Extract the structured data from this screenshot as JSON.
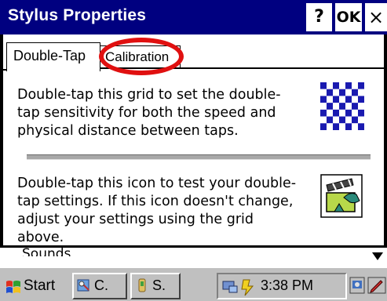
{
  "window": {
    "title": "Stylus Properties",
    "help_label": "?",
    "ok_label": "OK",
    "close_label": "×"
  },
  "tabs": [
    {
      "label": "Double-Tap",
      "active": true
    },
    {
      "label": "Calibration",
      "active": false,
      "highlighted": true
    }
  ],
  "content": {
    "section1_text": "Double-tap this grid to set the double-tap sensitivity for both the speed and physical distance between taps.",
    "section2_text": "Double-tap this icon to test your double-tap settings. If this icon doesn't change, adjust your settings using the grid above.",
    "grid_icon": "checkerboard-icon",
    "test_icon": "clapperboard-icon"
  },
  "behind": {
    "label": "Sounds"
  },
  "taskbar": {
    "start_label": "Start",
    "tasks": [
      {
        "label": "C.",
        "icon": "control-panel-icon"
      },
      {
        "label": "S.",
        "icon": "stylus-icon"
      }
    ],
    "clock": "3:38 PM",
    "tray_icons": [
      "network-icon",
      "power-icon"
    ],
    "desktop_icon": "desktop-icon",
    "pen_icon": "pen-input-icon"
  },
  "colors": {
    "titlebar": "#000080",
    "highlight": "#e01010",
    "taskbar": "#c0c0c0"
  }
}
